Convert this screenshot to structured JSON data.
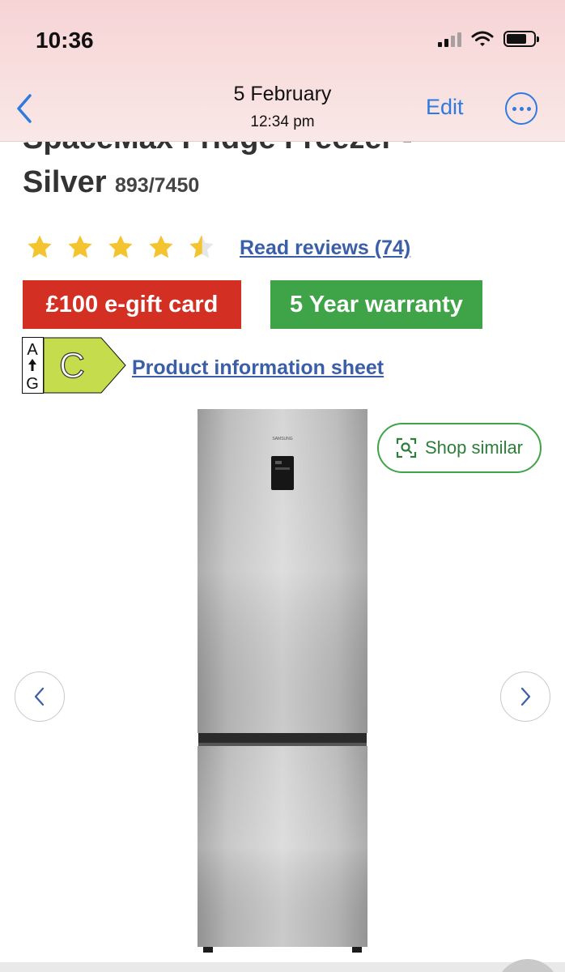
{
  "status_bar": {
    "time": "10:36",
    "battery_level": 0.75
  },
  "viewer_header": {
    "date": "5 February",
    "time": "12:34 pm",
    "edit_label": "Edit",
    "back_icon": "chevron-left-icon",
    "more_icon": "ellipsis-circle-icon",
    "accent_color": "#2f7ae0"
  },
  "product": {
    "title_line1_partial": "SpaceMax Fridge Freezer -",
    "title_line2": "Silver",
    "product_code": "893/7450",
    "rating": 4.5,
    "reviews_link": "Read reviews (74)",
    "offers": [
      {
        "label": "£100 e-gift card",
        "color": "#d32f23"
      },
      {
        "label": "5 Year warranty",
        "color": "#3ea447"
      }
    ],
    "energy_rating": {
      "scale_top": "A",
      "scale_bottom": "G",
      "class": "C",
      "color": "#c5dc4d"
    },
    "info_sheet_link": "Product information sheet",
    "shop_similar_label": "Shop similar",
    "brand_on_appliance": "SAMSUNG"
  },
  "carousel": {
    "prev_icon": "chevron-left-icon",
    "next_icon": "chevron-right-icon"
  }
}
